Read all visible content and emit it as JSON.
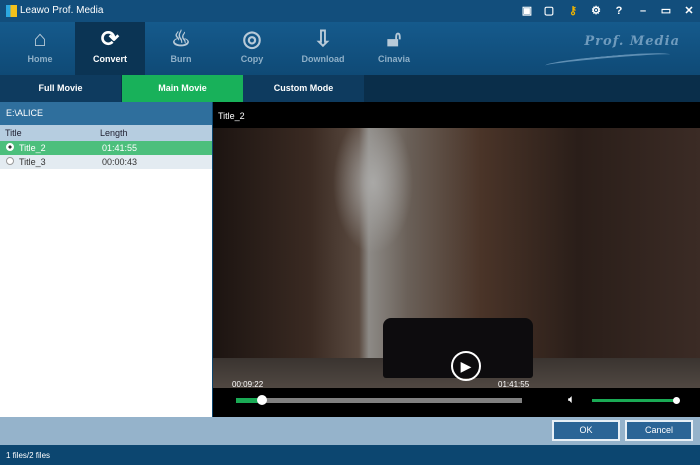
{
  "app": {
    "title": "Leawo Prof. Media",
    "brand": "Prof. Media"
  },
  "window_icons": [
    "monitor-icon",
    "chat-icon",
    "key-icon",
    "gear-icon",
    "help-icon",
    "minimize-icon",
    "maximize-icon",
    "close-icon"
  ],
  "nav": [
    {
      "label": "Home"
    },
    {
      "label": "Convert",
      "selected": true
    },
    {
      "label": "Burn"
    },
    {
      "label": "Copy"
    },
    {
      "label": "Download"
    },
    {
      "label": "Cinavia"
    }
  ],
  "tabs": [
    {
      "label": "Full Movie"
    },
    {
      "label": "Main Movie",
      "selected": true
    },
    {
      "label": "Custom Mode"
    }
  ],
  "left": {
    "path": "E:\\ALICE",
    "columns": [
      "Title",
      "Length"
    ],
    "rows": [
      {
        "title": "Title_2",
        "length": "01:41:55",
        "selected": true
      },
      {
        "title": "Title_3",
        "length": "00:00:43",
        "selected": false
      }
    ]
  },
  "player": {
    "title": "Title_2",
    "current_time": "00:09:22",
    "total_time": "01:41:55",
    "progress": 0.09,
    "volume": 1.0
  },
  "buttons": {
    "ok": "OK",
    "cancel": "Cancel"
  },
  "status": "1 files/2 files",
  "colors": {
    "accent": "#18b15a",
    "toolbar": "#124e7c"
  }
}
